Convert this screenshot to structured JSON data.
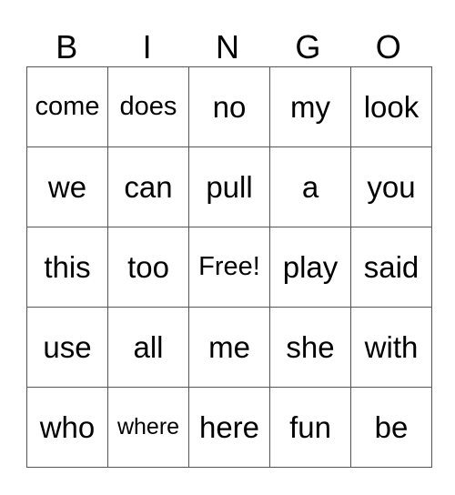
{
  "header": [
    "B",
    "I",
    "N",
    "G",
    "O"
  ],
  "rows": [
    [
      "come",
      "does",
      "no",
      "my",
      "look"
    ],
    [
      "we",
      "can",
      "pull",
      "a",
      "you"
    ],
    [
      "this",
      "too",
      "Free!",
      "play",
      "said"
    ],
    [
      "use",
      "all",
      "me",
      "she",
      "with"
    ],
    [
      "who",
      "where",
      "here",
      "fun",
      "be"
    ]
  ]
}
